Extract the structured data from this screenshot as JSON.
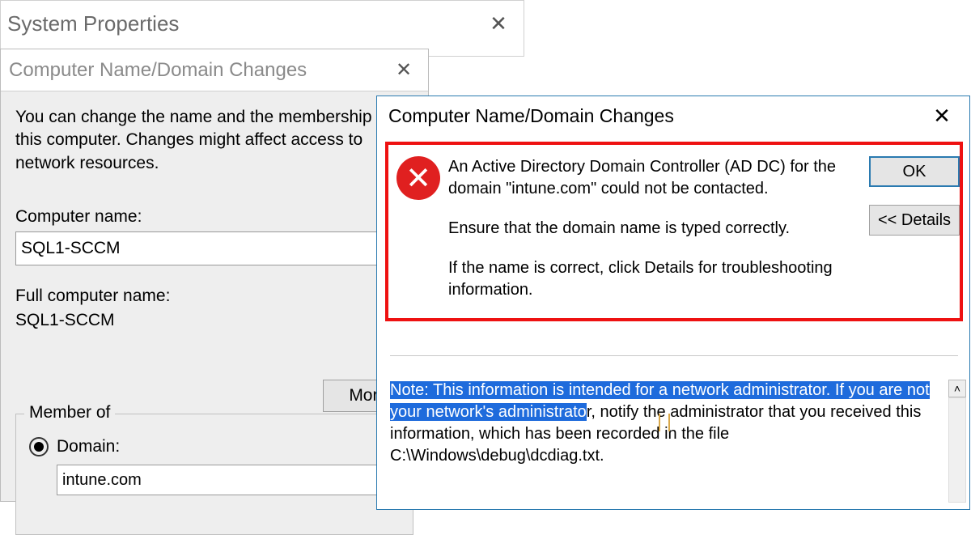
{
  "sysprops": {
    "title": "System Properties"
  },
  "domwin": {
    "title": "Computer Name/Domain Changes",
    "description": "You can change the name and the membership of this computer. Changes might affect access to network resources.",
    "computer_name_label": "Computer name:",
    "computer_name_value": "SQL1-SCCM",
    "full_name_label": "Full computer name:",
    "full_name_value": "SQL1-SCCM",
    "more_button": "More...",
    "member_of_legend": "Member of",
    "domain_radio_label": "Domain:",
    "domain_value": "intune.com"
  },
  "errwin": {
    "title": "Computer Name/Domain Changes",
    "message_line1": "An Active Directory Domain Controller (AD DC) for the domain \"intune.com\" could not be contacted.",
    "message_line2": "Ensure that the domain name is typed correctly.",
    "message_line3": "If the name is correct, click Details for troubleshooting information.",
    "ok_button": "OK",
    "details_button": "<< Details",
    "note_selected": "Note: This information is intended for a network administrator.  If you are not your network's administrato",
    "note_rest": "r, notify the administrator that you received this information, which has been recorded in the file C:\\Windows\\debug\\dcdiag.txt."
  }
}
